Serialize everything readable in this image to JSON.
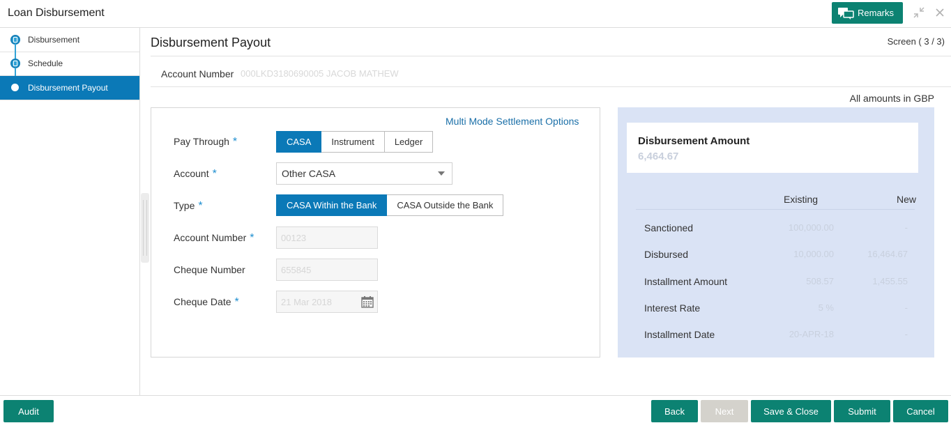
{
  "app": {
    "title": "Loan Disbursement"
  },
  "header": {
    "remarks_label": "Remarks"
  },
  "sidebar": {
    "steps": [
      {
        "label": "Disbursement"
      },
      {
        "label": "Schedule"
      },
      {
        "label": "Disbursement Payout"
      }
    ]
  },
  "page": {
    "title": "Disbursement Payout",
    "screen": "Screen ( 3 / 3)",
    "account_label": "Account Number",
    "account_value": "000LKD3180690005 JACOB MATHEW",
    "amounts_note": "All amounts in GBP"
  },
  "form": {
    "multimode_link": "Multi Mode Settlement Options",
    "pay_through": {
      "label": "Pay Through",
      "options": [
        "CASA",
        "Instrument",
        "Ledger"
      ],
      "selected": "CASA"
    },
    "account": {
      "label": "Account",
      "value": "Other CASA"
    },
    "type": {
      "label": "Type",
      "options": [
        "CASA Within the Bank",
        "CASA Outside the Bank"
      ],
      "selected": "CASA Within the Bank"
    },
    "account_number": {
      "label": "Account Number",
      "value": "00123"
    },
    "cheque_number": {
      "label": "Cheque Number",
      "value": "655845"
    },
    "cheque_date": {
      "label": "Cheque Date",
      "value": "21 Mar 2018"
    }
  },
  "summary": {
    "title": "Disbursement Amount",
    "amount": "6,464.67",
    "col_existing": "Existing",
    "col_new": "New",
    "rows": [
      {
        "label": "Sanctioned",
        "existing": "100,000.00",
        "new": "-"
      },
      {
        "label": "Disbursed",
        "existing": "10,000.00",
        "new": "16,464.67"
      },
      {
        "label": "Installment Amount",
        "existing": "508.57",
        "new": "1,455.55"
      },
      {
        "label": "Interest Rate",
        "existing": "5 %",
        "new": "-"
      },
      {
        "label": "Installment Date",
        "existing": "20-APR-18",
        "new": "-"
      }
    ]
  },
  "footer": {
    "audit": "Audit",
    "back": "Back",
    "next": "Next",
    "save_close": "Save & Close",
    "submit": "Submit",
    "cancel": "Cancel"
  },
  "colors": {
    "primary": "#0b79b7",
    "action": "#0c8272",
    "panel": "#dae3f5"
  }
}
